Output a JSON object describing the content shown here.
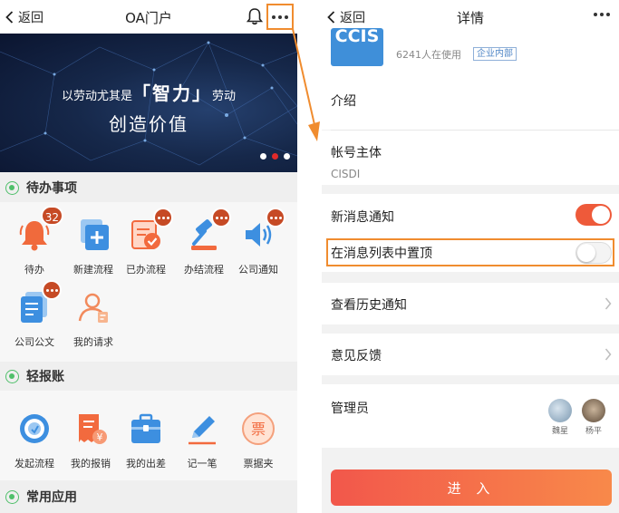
{
  "left": {
    "nav": {
      "back": "返回",
      "title": "OA门户"
    },
    "banner": {
      "pre": "以劳动尤其是",
      "quote_l": "「",
      "big": "智力",
      "quote_r": "」",
      "post": "劳动",
      "line2": "创造价值"
    },
    "sections": [
      {
        "title": "待办事项"
      },
      {
        "title": "轻报账"
      },
      {
        "title": "常用应用"
      }
    ],
    "todo": [
      {
        "label": "待办",
        "icon": "bell-icon",
        "badge": "32"
      },
      {
        "label": "新建流程",
        "icon": "add-process-icon"
      },
      {
        "label": "已办流程",
        "icon": "done-process-icon",
        "badge_dots": true
      },
      {
        "label": "办结流程",
        "icon": "gavel-icon",
        "badge_dots": true
      },
      {
        "label": "公司通知",
        "icon": "speaker-icon",
        "badge_dots": true
      },
      {
        "label": "公司公文",
        "icon": "document-icon",
        "badge_dots": true
      },
      {
        "label": "我的请求",
        "icon": "user-request-icon"
      }
    ],
    "reimburse": [
      {
        "label": "发起流程",
        "icon": "start-process-icon"
      },
      {
        "label": "我的报销",
        "icon": "receipt-yen-icon"
      },
      {
        "label": "我的出差",
        "icon": "briefcase-icon"
      },
      {
        "label": "记一笔",
        "icon": "pen-icon"
      },
      {
        "label": "票据夹",
        "icon": "ticket-icon",
        "icon_char": "票"
      }
    ]
  },
  "right": {
    "nav": {
      "back": "返回",
      "title": "详情"
    },
    "app": {
      "logo": "CCIS",
      "users": "6241人在使用",
      "tag": "企业内部"
    },
    "intro": "介绍",
    "account": {
      "label": "帐号主体",
      "value": "CISDI"
    },
    "notify": {
      "label": "新消息通知",
      "on": true
    },
    "pin": {
      "label": "在消息列表中置顶",
      "on": false
    },
    "history": "查看历史通知",
    "feedback": "意见反馈",
    "admins": {
      "label": "管理员",
      "people": [
        {
          "name": "魏星"
        },
        {
          "name": "杨平"
        }
      ]
    },
    "enter": "进 入"
  },
  "colors": {
    "accent": "#ee5a3a",
    "highlight": "#f08c2f",
    "badge": "#c64a25",
    "section_icon": "#4fbf6a"
  }
}
